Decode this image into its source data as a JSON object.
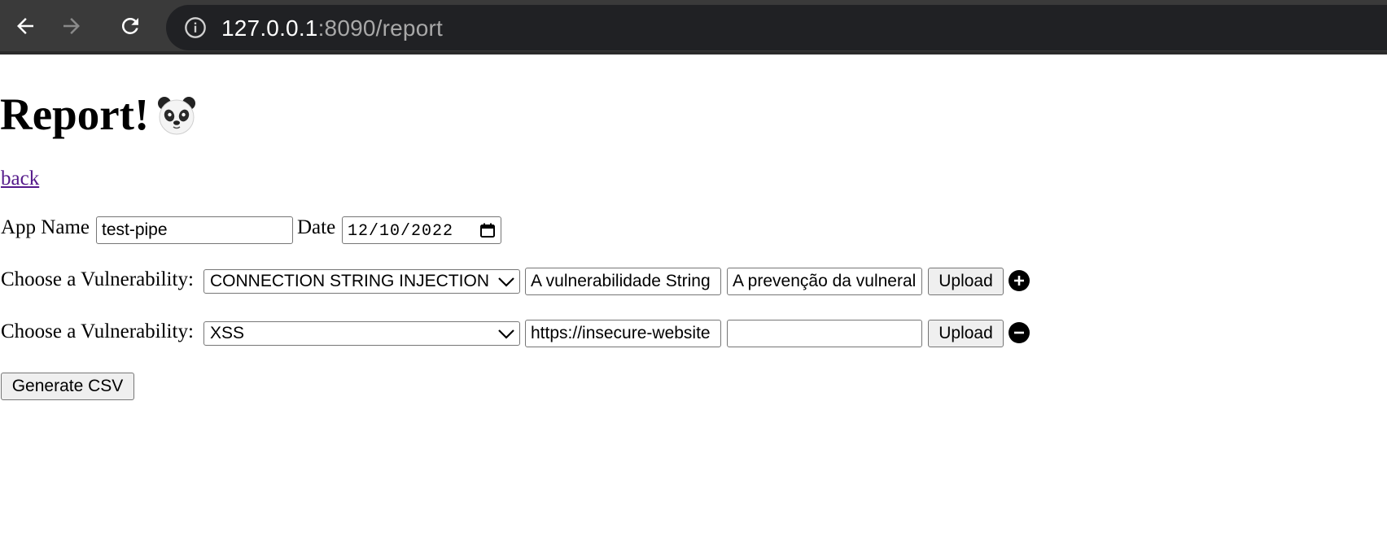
{
  "browser": {
    "url_host": "127.0.0.1",
    "url_rest": ":8090/report",
    "icons": [
      "back-arrow-icon",
      "forward-arrow-icon",
      "reload-icon",
      "info-icon"
    ]
  },
  "page": {
    "title": "Report! 🐼",
    "title_text": "Report!",
    "back_link": "back"
  },
  "form": {
    "app_name_label": "App Name",
    "app_name_value": "test-pipe",
    "date_label": "Date",
    "date_value": "12/10/2022",
    "vulnerabilities": [
      {
        "label": "Choose a Vulnerability:",
        "selected": "CONNECTION STRING INJECTION",
        "description": "A vulnerabilidade String",
        "prevention": "A prevenção da vulneral",
        "upload_label": "Upload",
        "action_icon": "plus-circle-icon"
      },
      {
        "label": "Choose a Vulnerability:",
        "selected": "XSS",
        "description": "https://insecure-website",
        "prevention": "",
        "upload_label": "Upload",
        "action_icon": "minus-circle-icon"
      }
    ],
    "generate_label": "Generate CSV"
  }
}
